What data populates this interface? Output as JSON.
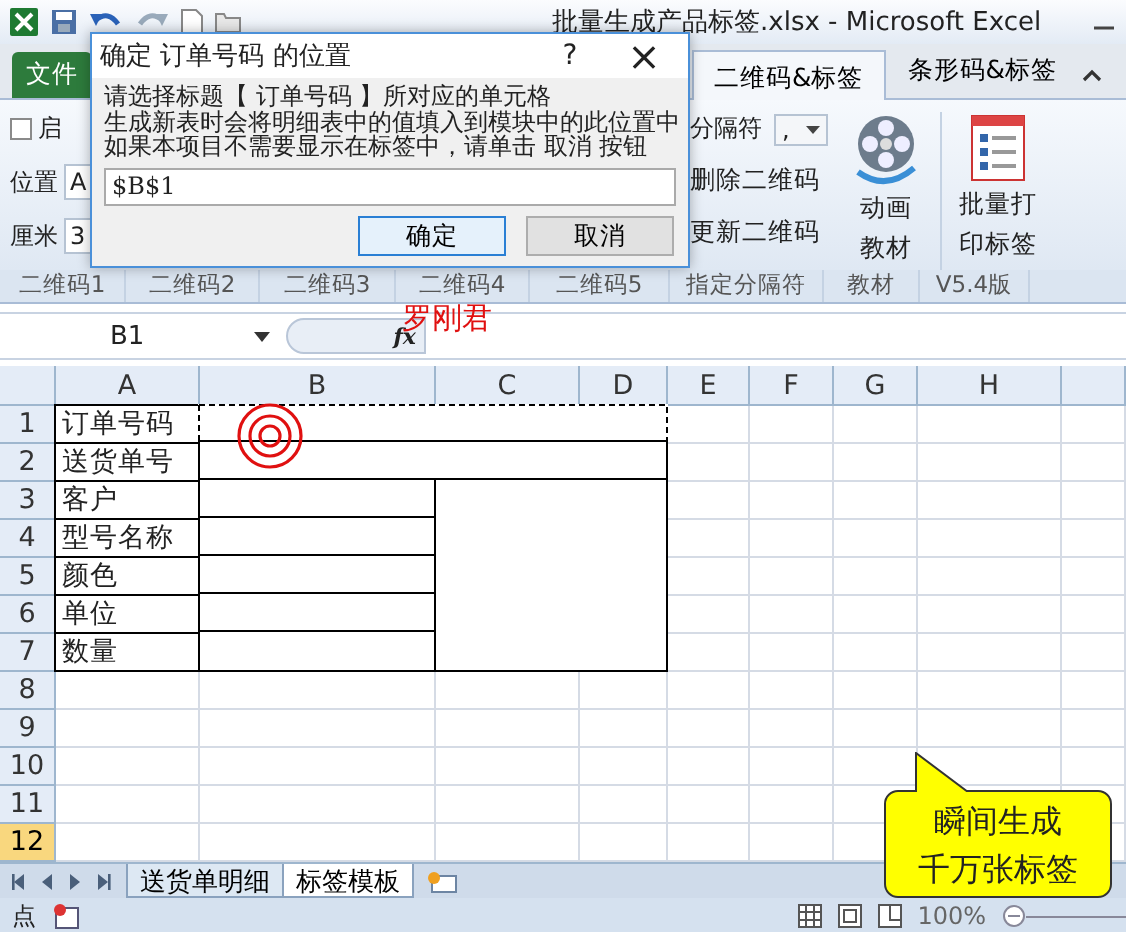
{
  "window": {
    "title": "批量生成产品标签.xlsx - Microsoft Excel"
  },
  "ribbon": {
    "file_tab": "文件",
    "tabs": [
      {
        "label": "二维码&标签",
        "selected": true
      },
      {
        "label": "条形码&标签",
        "selected": false
      }
    ],
    "left_controls": [
      {
        "kind": "checkbox",
        "label": "启",
        "checked": false
      },
      {
        "kind": "field",
        "label": "位置",
        "value": "A"
      },
      {
        "kind": "field",
        "label": "厘米",
        "value": "3"
      }
    ],
    "separator": {
      "label": "分隔符",
      "value": ","
    },
    "actions": [
      "删除二维码",
      "更新二维码"
    ],
    "large_buttons": [
      {
        "kind": "reel",
        "lines": [
          "动画",
          "教材"
        ]
      },
      {
        "kind": "list",
        "lines": [
          "批量打",
          "印标签"
        ]
      }
    ],
    "group_labels": [
      "二维码1",
      "二维码2",
      "二维码3",
      "二维码4",
      "二维码5",
      "指定分隔符",
      "教材",
      "V5.4版"
    ]
  },
  "formula_bar": {
    "name_box": "B1",
    "function_label": "fx"
  },
  "annotation": {
    "text": "罗刚君"
  },
  "sheet": {
    "columns": [
      {
        "label": "A",
        "selected": false
      },
      {
        "label": "B",
        "selected": false
      },
      {
        "label": "C",
        "selected": false
      },
      {
        "label": "D",
        "selected": false
      },
      {
        "label": "E",
        "selected": false
      },
      {
        "label": "F",
        "selected": false
      },
      {
        "label": "G",
        "selected": false
      },
      {
        "label": "H",
        "selected": false
      }
    ],
    "rows": [
      {
        "header": "1",
        "selected": false,
        "label": "订单号码"
      },
      {
        "header": "2",
        "selected": false,
        "label": "送货单号"
      },
      {
        "header": "3",
        "selected": false,
        "label": "客户"
      },
      {
        "header": "4",
        "selected": false,
        "label": "型号名称"
      },
      {
        "header": "5",
        "selected": false,
        "label": "颜色"
      },
      {
        "header": "6",
        "selected": false,
        "label": "单位"
      },
      {
        "header": "7",
        "selected": false,
        "label": "数量"
      },
      {
        "header": "8",
        "selected": false
      },
      {
        "header": "9",
        "selected": false
      },
      {
        "header": "10",
        "selected": false
      },
      {
        "header": "11",
        "selected": false
      },
      {
        "header": "12",
        "selected": true
      }
    ]
  },
  "sheet_tabs": [
    {
      "label": "送货单明细",
      "selected": false
    },
    {
      "label": "标签模板",
      "selected": true
    }
  ],
  "status_bar": {
    "mode": "点",
    "zoom": "100%"
  },
  "dialog": {
    "title": "确定 订单号码 的位置",
    "help": "?",
    "close": "×",
    "message": [
      "请选择标题【 订单号码 】所对应的单元格",
      "生成新表时会将明细表中的值填入到模块中的此位置中",
      "如果本项目不需要显示在标签中，请单击 取消 按钮"
    ],
    "value": "$B$1",
    "buttons": [
      {
        "label": "确定",
        "default": true
      },
      {
        "label": "取消",
        "default": false
      }
    ]
  },
  "callout": {
    "lines": [
      "瞬间生成",
      "千万张标签"
    ]
  }
}
